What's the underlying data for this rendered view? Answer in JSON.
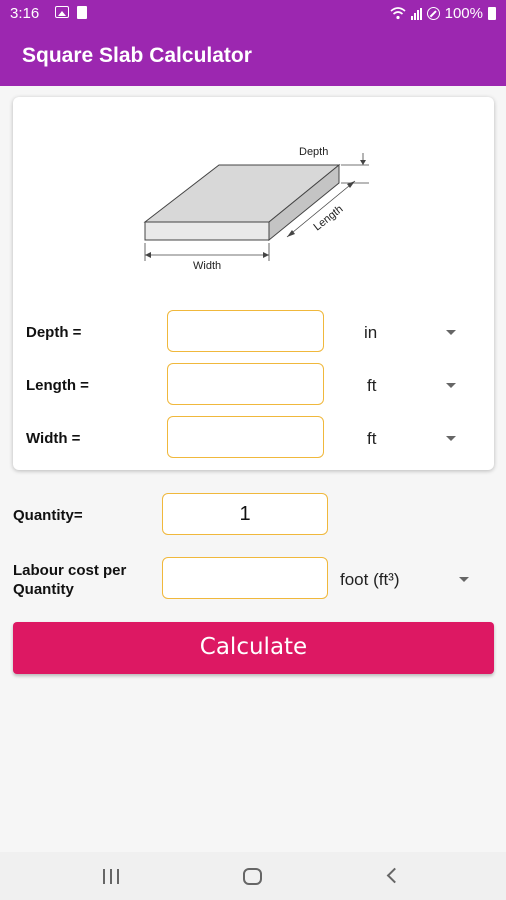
{
  "status_bar": {
    "time": "3:16",
    "battery": "100%"
  },
  "app_bar": {
    "title": "Square Slab Calculator"
  },
  "diagram": {
    "depth_label": "Depth",
    "length_label": "Length",
    "width_label": "Width"
  },
  "dimensions": [
    {
      "label": "Depth =",
      "value": "",
      "unit": "in"
    },
    {
      "label": "Length =",
      "value": "",
      "unit": "ft"
    },
    {
      "label": "Width =",
      "value": "",
      "unit": "ft"
    }
  ],
  "quantity": {
    "label": "Quantity=",
    "value": "1"
  },
  "labour": {
    "label_line1": "Labour cost per",
    "label_line2": "Quantity",
    "value": "",
    "unit": "foot (ft³)"
  },
  "calculate_button": {
    "label": "Calculate"
  },
  "colors": {
    "primary": "#9c27b0",
    "accent": "#dd1863",
    "field_border": "#f0b83c"
  }
}
